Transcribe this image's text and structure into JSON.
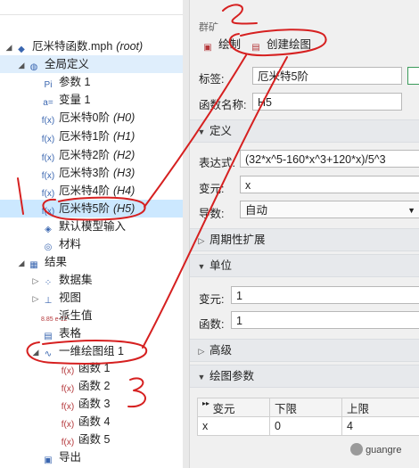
{
  "tree": {
    "root": {
      "name": "厄米特函数.mph",
      "suffix": "(root)"
    },
    "global_defs": "全局定义",
    "params": "参数 1",
    "vars": "变量 1",
    "funcs": [
      {
        "name": "厄米特0阶",
        "tag": "(H0)"
      },
      {
        "name": "厄米特1阶",
        "tag": "(H1)"
      },
      {
        "name": "厄米特2阶",
        "tag": "(H2)"
      },
      {
        "name": "厄米特3阶",
        "tag": "(H3)"
      },
      {
        "name": "厄米特4阶",
        "tag": "(H4)"
      },
      {
        "name": "厄米特5阶",
        "tag": "(H5)"
      }
    ],
    "default_input": "默认模型输入",
    "materials": "材料",
    "results": "结果",
    "datasets": "数据集",
    "views": "视图",
    "derived": "派生值",
    "derived_icon": "8.85 e-12",
    "tables": "表格",
    "plot_group": "一维绘图组 1",
    "plot_funcs": [
      "函数 1",
      "函数 2",
      "函数 3",
      "函数 4",
      "函数 5"
    ],
    "export": "导出"
  },
  "panel": {
    "title_fragment": "群矿",
    "plot_btn": "绘制",
    "create_plot_btn": "创建绘图",
    "label_label": "标签:",
    "label_value": "厄米特5阶",
    "funcname_label": "函数名称:",
    "funcname_value": "H5",
    "sec_define": "定义",
    "expr_label": "表达式:",
    "expr_value": "(32*x^5-160*x^3+120*x)/5^3",
    "var_label": "变元:",
    "var_value": "x",
    "deriv_label": "导数:",
    "deriv_value": "自动",
    "sec_periodic": "周期性扩展",
    "sec_units": "单位",
    "unit_arg_label": "变元:",
    "unit_arg_value": "1",
    "unit_func_label": "函数:",
    "unit_func_value": "1",
    "sec_advanced": "高级",
    "sec_plot_params": "绘图参数",
    "table": {
      "headers": [
        "变元",
        "下限",
        "上限"
      ],
      "row": [
        "x",
        "0",
        "4"
      ]
    }
  },
  "watermark": "guangre"
}
